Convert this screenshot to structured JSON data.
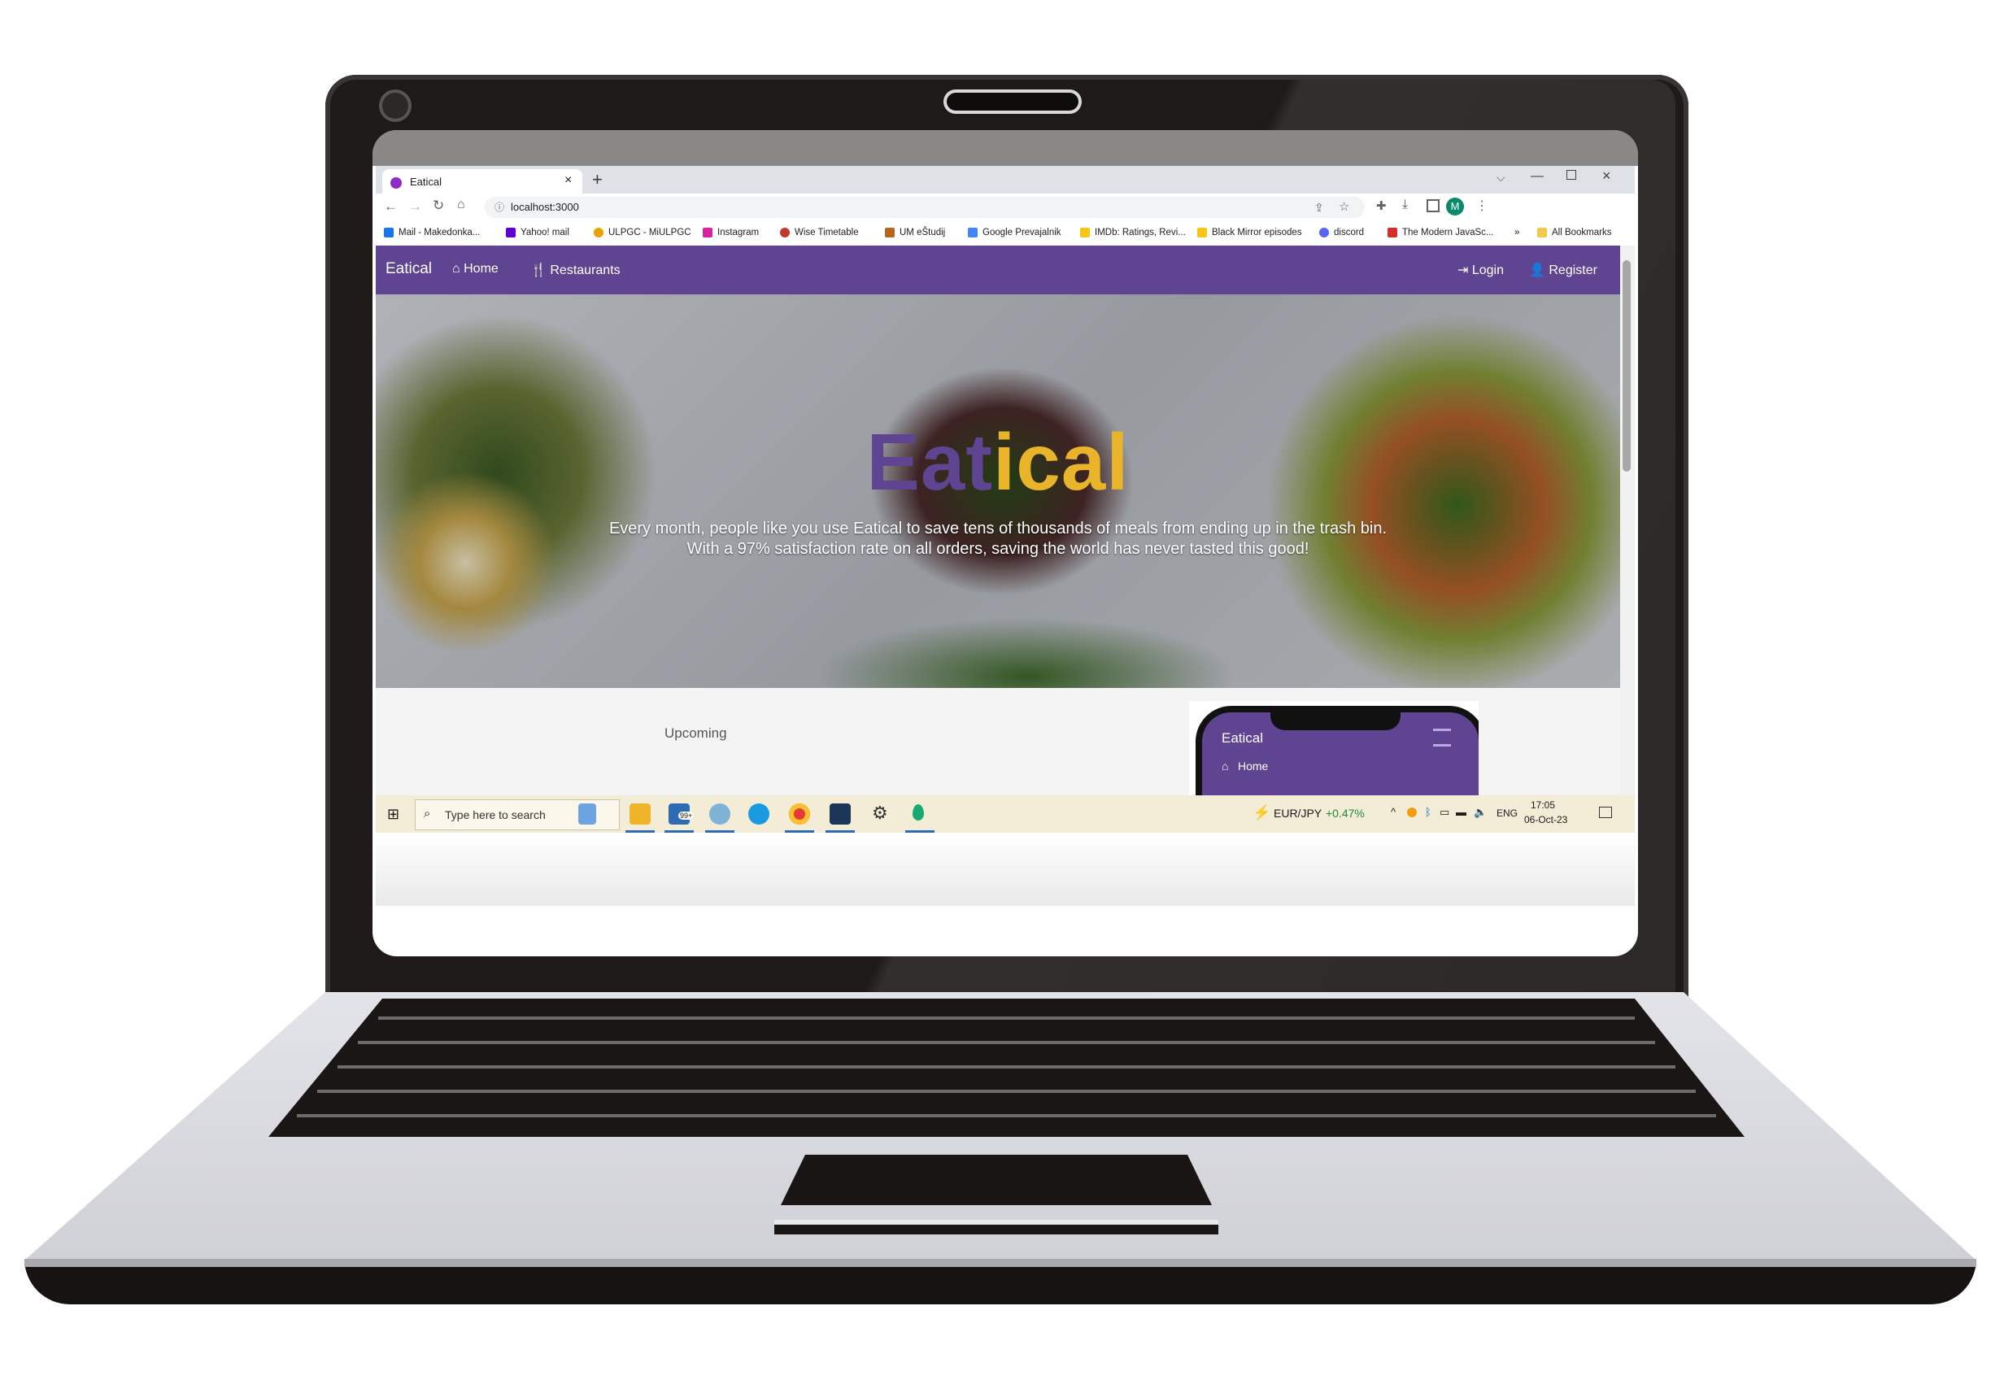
{
  "browser": {
    "tab_title": "Eatical",
    "url": "localhost:3000",
    "bookmarks": [
      {
        "label": "Mail - Makedonka...",
        "color": "#1a73e8"
      },
      {
        "label": "Yahoo! mail",
        "color": "#6001d2"
      },
      {
        "label": "ULPGC - MiULPGC",
        "color": "#e8a200"
      },
      {
        "label": "Instagram",
        "color": "#d6249f"
      },
      {
        "label": "Wise Timetable",
        "color": "#c0392b"
      },
      {
        "label": "UM eŠtudij",
        "color": "#b5651d"
      },
      {
        "label": "Google Prevajalnik",
        "color": "#4285f4"
      },
      {
        "label": "IMDb: Ratings, Revi...",
        "color": "#f5c518"
      },
      {
        "label": "Black Mirror episodes",
        "color": "#f5c518"
      },
      {
        "label": "discord",
        "color": "#5865f2"
      },
      {
        "label": "The Modern JavaSc...",
        "color": "#d32f2f"
      }
    ],
    "bookmarks_overflow": "»",
    "all_bookmarks": "All Bookmarks",
    "profile_initial": "M"
  },
  "site": {
    "brand": "Eatical",
    "nav": {
      "home": "Home",
      "restaurants": "Restaurants",
      "login": "Login",
      "register": "Register"
    },
    "hero": {
      "title_part1": "Eat",
      "title_part2": "ical",
      "line1": "Every month, people like you use Eatical to save tens of thousands of meals from ending up in the trash bin.",
      "line2": "With a 97% satisfaction rate on all orders, saving the world has never tasted this good!"
    },
    "upcoming": "Upcoming",
    "phone": {
      "brand": "Eatical",
      "home": "Home"
    }
  },
  "taskbar": {
    "search_placeholder": "Type here to search",
    "ticker": "EUR/JPY",
    "ticker_change": "+0.47%",
    "language": "ENG",
    "time": "17:05",
    "date": "06-Oct-23",
    "mail_badge": "99+"
  },
  "colors": {
    "brand_purple": "#5e4491",
    "brand_gold": "#e9b32a",
    "ticker_up": "#1e8a3a"
  }
}
